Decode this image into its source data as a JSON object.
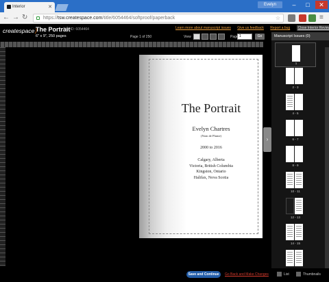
{
  "browser": {
    "tab_title": "Interior",
    "user": "Evelyn",
    "url_scheme": "https://",
    "url_host": "tsw.createspace.com",
    "url_path": "/title/6054464/softproof/paperback"
  },
  "header": {
    "logo_text": "createspace",
    "title": "The Portrait",
    "title_id": "Title ID: 6054464",
    "trim_info": "6\" x 9\", 250 pages",
    "links": [
      "Learn more about manuscript issues",
      "Give us feedback",
      "Report a bug"
    ],
    "clear_label": "Close Interior Reviewer",
    "page_of": "Page 1 of 250",
    "view_label": "View",
    "page_label": "Page",
    "page_value": "1",
    "go_label": "Go"
  },
  "panel": {
    "title": "Manuscript Issues (0)",
    "thumb_labels": [
      "1",
      "2 - 3",
      "4 - 5",
      "6 - 7",
      "8 - 9",
      "10 - 11",
      "12 - 13",
      "14 - 15"
    ]
  },
  "page": {
    "title": "The Portrait",
    "author": "Evelyn Chartres",
    "nom": "(Nom de Plume)",
    "years": "2000 to 2016",
    "places": [
      "Calgary, Alberta",
      "Victoria, British Columbia",
      "Kingston, Ontario",
      "Halifax, Nova Scotia"
    ]
  },
  "footer": {
    "save_label": "Save and Continue",
    "goback_label": "Go Back and Make Changes",
    "list_label": "List",
    "thumbs_label": "Thumbnails"
  },
  "colors": {
    "accent_orange": "#e87a1e",
    "link_orange": "#f2a23c",
    "save_blue": "#235da8",
    "warn_red": "#d63a2c"
  }
}
